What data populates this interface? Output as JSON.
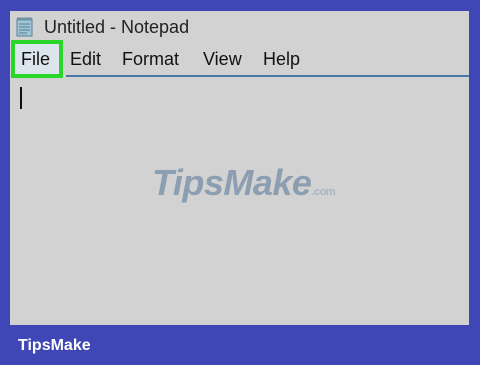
{
  "window": {
    "title": "Untitled - Notepad",
    "icon": "notepad-icon"
  },
  "menu": {
    "items": [
      "File",
      "Edit",
      "Format",
      "View",
      "Help"
    ],
    "highlighted": "File"
  },
  "editor": {
    "content": ""
  },
  "watermark": {
    "brand": "TipsMake",
    "suffix": ".com"
  },
  "footer": {
    "brand": "TipsMake"
  },
  "colors": {
    "background": "#3e47b5",
    "window": "#d2d2d2",
    "highlight_border": "#2bd62b",
    "menu_line": "#4a79a8",
    "watermark": "#8c9eb2"
  }
}
